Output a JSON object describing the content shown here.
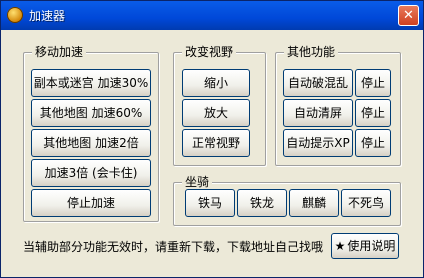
{
  "window": {
    "title": "加速器",
    "close_glyph": "✕"
  },
  "groups": {
    "move_speed": {
      "label": "移动加速",
      "buttons": [
        "副本或迷宫 加速30%",
        "其他地图 加速60%",
        "其他地图 加速2倍",
        "加速3倍 (会卡住)",
        "停止加速"
      ]
    },
    "view": {
      "label": "改变视野",
      "buttons": [
        "缩小",
        "放大",
        "正常视野"
      ]
    },
    "other": {
      "label": "其他功能",
      "rows": [
        {
          "action": "自动破混乱",
          "stop": "停止"
        },
        {
          "action": "自动清屏",
          "stop": "停止"
        },
        {
          "action": "自动提示XP",
          "stop": "停止"
        }
      ]
    },
    "mount": {
      "label": "坐骑",
      "buttons": [
        "铁马",
        "铁龙",
        "麒麟",
        "不死鸟"
      ]
    }
  },
  "footer": {
    "status_text": "当辅助部分功能无效时，请重新下载，下载地址自己找哦",
    "help_icon": "★",
    "help_label": "使用说明"
  }
}
